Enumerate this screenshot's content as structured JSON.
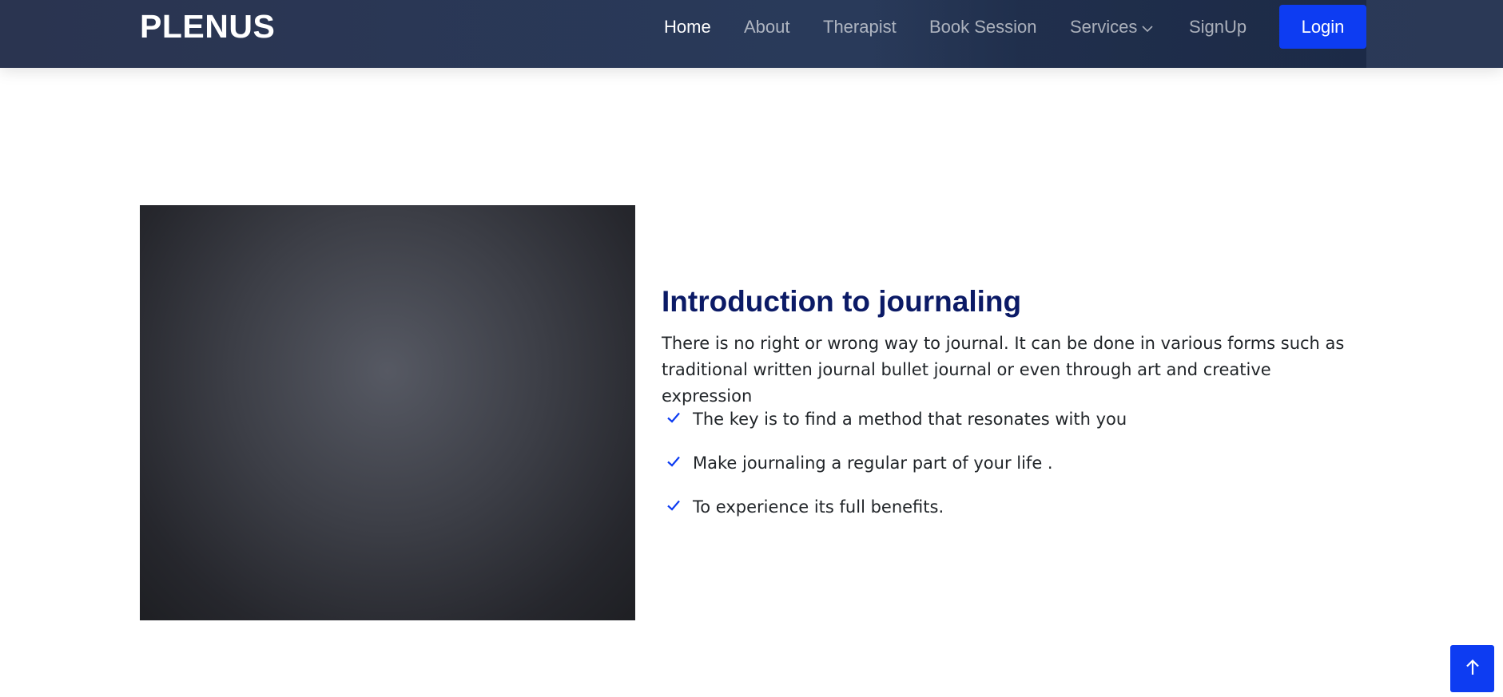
{
  "brand": {
    "logo_text": "PLENUS"
  },
  "nav": {
    "items": [
      {
        "label": "Home",
        "active": true
      },
      {
        "label": "About"
      },
      {
        "label": "Therapist"
      },
      {
        "label": "Book Session"
      },
      {
        "label": "Services",
        "has_dropdown": true
      },
      {
        "label": "SignUp"
      }
    ],
    "login_label": "Login"
  },
  "about": {
    "title": "Introduction to journaling",
    "lead": "There is no right or wrong way to journal. It can be done in various forms such as traditional written journal bullet journal or even through art and creative expression",
    "checklist": [
      "The key is to find a method that resonates with you",
      "Make journaling a regular part of your life .",
      "To experience its full benefits."
    ]
  },
  "colors": {
    "header_bg": "#293a5a",
    "accent": "#0d3cf2",
    "heading": "#0b1a66",
    "body_text": "#212529"
  },
  "icons": {
    "dropdown": "chevron-down-icon",
    "check": "check-icon",
    "back_to_top": "arrow-up-icon"
  }
}
